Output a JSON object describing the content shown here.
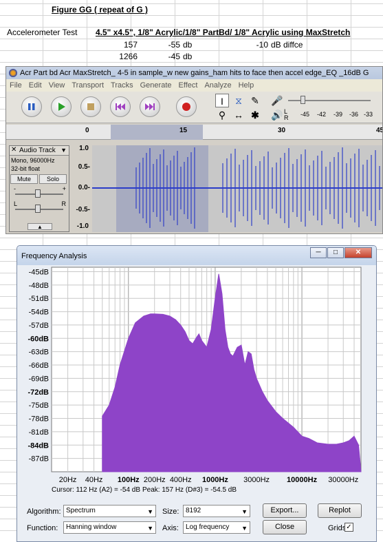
{
  "sheet": {
    "figure_title": "Figure GG ( repeat of G )",
    "test_label": "Accelerometer Test",
    "test_desc": "4.5\" x4.5\", 1/8\" Acrylic/1/8\" PartBd/ 1/8\" Acrylic using MaxStretch",
    "row1": {
      "a": "157",
      "b": "-55",
      "c": "db",
      "d": "-10",
      "e": "dB diffce"
    },
    "row2": {
      "a": "1266",
      "b": "-45",
      "c": "db"
    }
  },
  "audacity": {
    "title": "Acr Part bd Acr MaxStretch_ 4-5 in sample_w new gains_ham hits to face then accel edge_EQ _16dB G",
    "menu": [
      "File",
      "Edit",
      "View",
      "Transport",
      "Tracks",
      "Generate",
      "Effect",
      "Analyze",
      "Help"
    ],
    "meter_ticks": [
      "-45",
      "-42",
      "-39",
      "-36",
      "-33"
    ],
    "meter_lr": [
      "L",
      "R"
    ],
    "ruler_ticks": [
      "0",
      "15",
      "30",
      "45"
    ],
    "track": {
      "name": "Audio Track",
      "info1": "Mono, 96000Hz",
      "info2": "32-bit float",
      "mute": "Mute",
      "solo": "Solo",
      "gain_minus": "-",
      "gain_plus": "+",
      "pan_l": "L",
      "pan_r": "R"
    },
    "vscale": [
      "1.0",
      "0.5-",
      "0.0-",
      "-0.5-",
      "-1.0"
    ]
  },
  "freq": {
    "window_title": "Frequency Analysis",
    "cursor_text": "Cursor: 112 Hz (A2) = -54 dB",
    "peak_text": "Peak: 157 Hz (D#3) = -54.5 dB",
    "algorithm_label": "Algorithm:",
    "algorithm_value": "Spectrum",
    "size_label": "Size:",
    "size_value": "8192",
    "function_label": "Function:",
    "function_value": "Hanning window",
    "axis_label": "Axis:",
    "axis_value": "Log frequency",
    "export_label": "Export...",
    "replot_label": "Replot",
    "close_label": "Close",
    "grids_label": "Grids",
    "grids_checked": true,
    "fill_color": "#8e44c8"
  },
  "chart_data": {
    "type": "area",
    "xscale": "log",
    "xlim": [
      50,
      48000
    ],
    "ylim": [
      -90,
      -44
    ],
    "yticks": [
      "-45dB",
      "-48dB",
      "-51dB",
      "-54dB",
      "-57dB",
      "-60dB",
      "-63dB",
      "-66dB",
      "-69dB",
      "-72dB",
      "-75dB",
      "-78dB",
      "-81dB",
      "-84dB",
      "-87dB"
    ],
    "xticks": [
      "20Hz",
      "40Hz",
      "100Hz",
      "200Hz",
      "400Hz",
      "1000Hz",
      "3000Hz",
      "10000Hz",
      "30000Hz"
    ],
    "xticks_bold": [
      "100Hz",
      "1000Hz",
      "10000Hz"
    ],
    "grid": true,
    "x": [
      50,
      60,
      70,
      80,
      100,
      120,
      150,
      180,
      200,
      250,
      300,
      350,
      400,
      450,
      500,
      550,
      600,
      650,
      700,
      800,
      900,
      1000,
      1100,
      1200,
      1300,
      1400,
      1500,
      1600,
      1800,
      2000,
      2200,
      2400,
      2600,
      2800,
      3000,
      3500,
      4000,
      5000,
      6000,
      8000,
      10000,
      12000,
      15000,
      20000,
      25000,
      30000,
      35000,
      40000,
      45000,
      48000
    ],
    "y": [
      -77.5,
      -75,
      -71,
      -66,
      -60,
      -56.5,
      -55,
      -54.5,
      -54.5,
      -54.6,
      -55,
      -55.8,
      -57,
      -58.5,
      -60.5,
      -61.2,
      -60,
      -59,
      -60.5,
      -62,
      -58,
      -51,
      -45.5,
      -50,
      -58,
      -62,
      -63.5,
      -64,
      -62,
      -61.5,
      -66,
      -63,
      -63.5,
      -67,
      -69,
      -72,
      -74,
      -76.5,
      -78,
      -80,
      -82,
      -82.5,
      -83.5,
      -83.8,
      -83.8,
      -83.5,
      -83,
      -82,
      -84,
      -90
    ]
  }
}
